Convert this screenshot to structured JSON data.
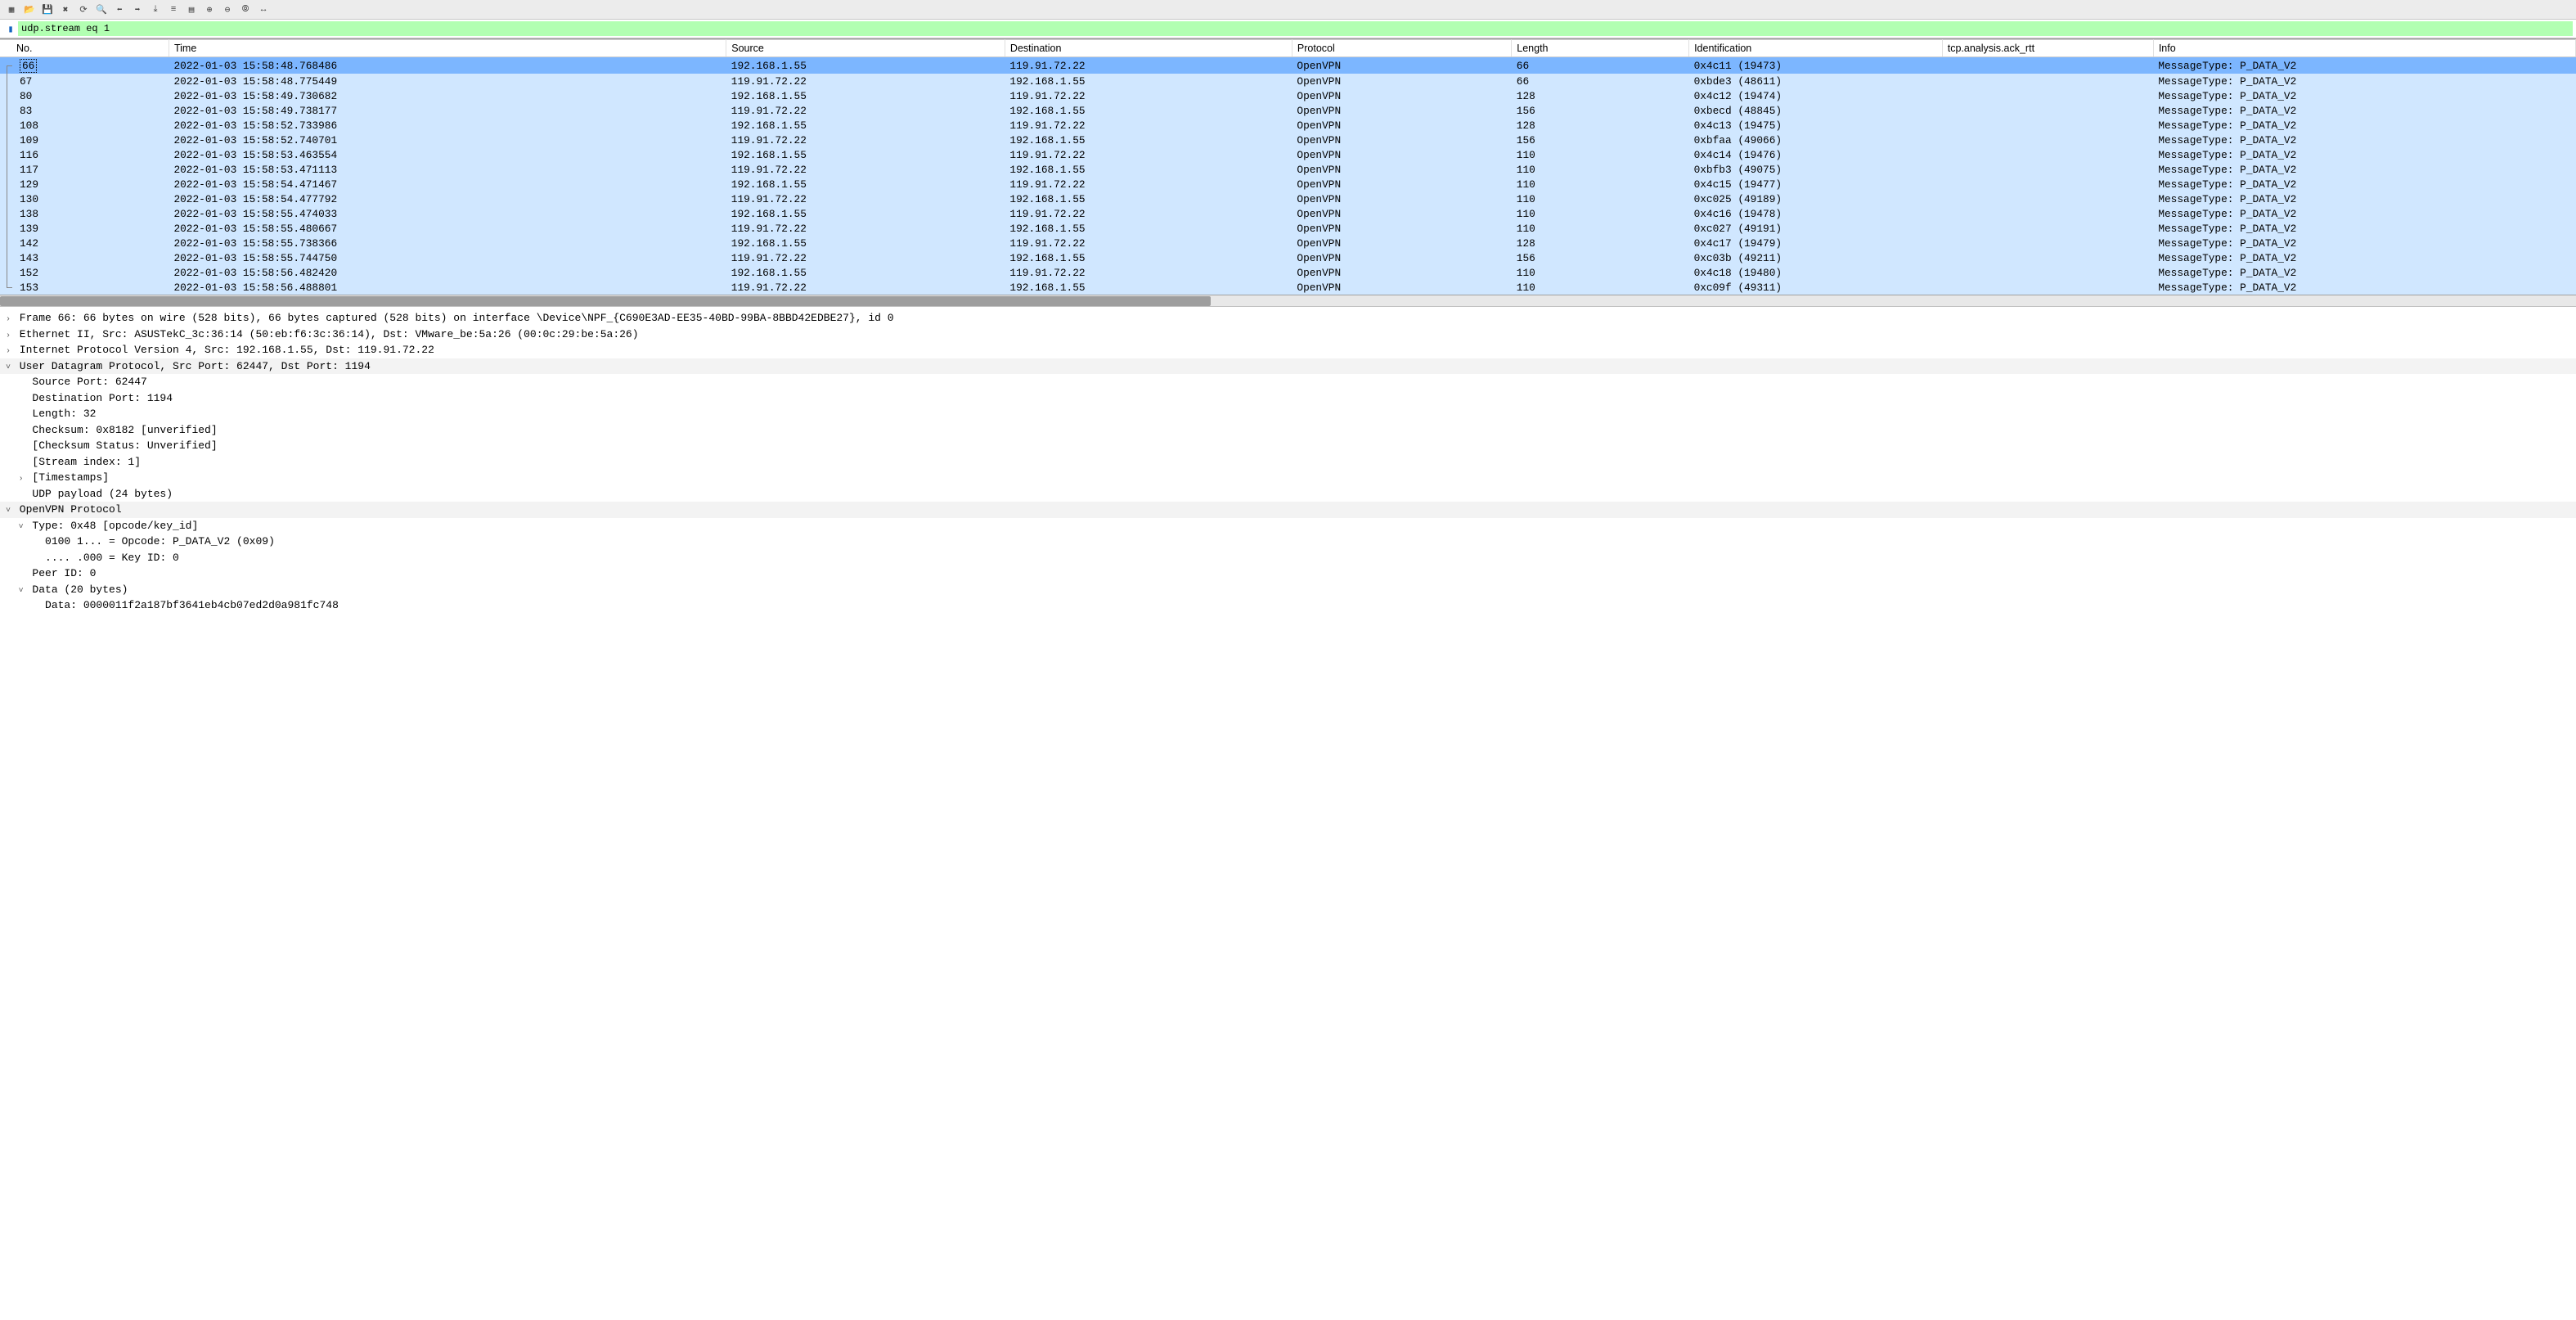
{
  "toolbar_icons": [
    "file-icon",
    "open-icon",
    "save-icon",
    "close-icon",
    "reload-icon",
    "find-icon",
    "go-back-icon",
    "go-fwd-icon",
    "go-last-icon",
    "auto-scroll-icon",
    "colorize-icon",
    "zoom-in-icon",
    "zoom-out-icon",
    "zoom-reset-icon",
    "resize-icon"
  ],
  "filter": {
    "value": "udp.stream eq 1"
  },
  "columns": {
    "no": "No.",
    "time": "Time",
    "src": "Source",
    "dst": "Destination",
    "proto": "Protocol",
    "len": "Length",
    "id": "Identification",
    "rtt": "tcp.analysis.ack_rtt",
    "info": "Info"
  },
  "rows": [
    {
      "no": "66",
      "time": "2022-01-03 15:58:48.768486",
      "src": "192.168.1.55",
      "dst": "119.91.72.22",
      "proto": "OpenVPN",
      "len": "66",
      "id": "0x4c11 (19473)",
      "info": "MessageType: P_DATA_V2",
      "sel": true
    },
    {
      "no": "67",
      "time": "2022-01-03 15:58:48.775449",
      "src": "119.91.72.22",
      "dst": "192.168.1.55",
      "proto": "OpenVPN",
      "len": "66",
      "id": "0xbde3 (48611)",
      "info": "MessageType: P_DATA_V2"
    },
    {
      "no": "80",
      "time": "2022-01-03 15:58:49.730682",
      "src": "192.168.1.55",
      "dst": "119.91.72.22",
      "proto": "OpenVPN",
      "len": "128",
      "id": "0x4c12 (19474)",
      "info": "MessageType: P_DATA_V2"
    },
    {
      "no": "83",
      "time": "2022-01-03 15:58:49.738177",
      "src": "119.91.72.22",
      "dst": "192.168.1.55",
      "proto": "OpenVPN",
      "len": "156",
      "id": "0xbecd (48845)",
      "info": "MessageType: P_DATA_V2"
    },
    {
      "no": "108",
      "time": "2022-01-03 15:58:52.733986",
      "src": "192.168.1.55",
      "dst": "119.91.72.22",
      "proto": "OpenVPN",
      "len": "128",
      "id": "0x4c13 (19475)",
      "info": "MessageType: P_DATA_V2"
    },
    {
      "no": "109",
      "time": "2022-01-03 15:58:52.740701",
      "src": "119.91.72.22",
      "dst": "192.168.1.55",
      "proto": "OpenVPN",
      "len": "156",
      "id": "0xbfaa (49066)",
      "info": "MessageType: P_DATA_V2"
    },
    {
      "no": "116",
      "time": "2022-01-03 15:58:53.463554",
      "src": "192.168.1.55",
      "dst": "119.91.72.22",
      "proto": "OpenVPN",
      "len": "110",
      "id": "0x4c14 (19476)",
      "info": "MessageType: P_DATA_V2"
    },
    {
      "no": "117",
      "time": "2022-01-03 15:58:53.471113",
      "src": "119.91.72.22",
      "dst": "192.168.1.55",
      "proto": "OpenVPN",
      "len": "110",
      "id": "0xbfb3 (49075)",
      "info": "MessageType: P_DATA_V2"
    },
    {
      "no": "129",
      "time": "2022-01-03 15:58:54.471467",
      "src": "192.168.1.55",
      "dst": "119.91.72.22",
      "proto": "OpenVPN",
      "len": "110",
      "id": "0x4c15 (19477)",
      "info": "MessageType: P_DATA_V2"
    },
    {
      "no": "130",
      "time": "2022-01-03 15:58:54.477792",
      "src": "119.91.72.22",
      "dst": "192.168.1.55",
      "proto": "OpenVPN",
      "len": "110",
      "id": "0xc025 (49189)",
      "info": "MessageType: P_DATA_V2"
    },
    {
      "no": "138",
      "time": "2022-01-03 15:58:55.474033",
      "src": "192.168.1.55",
      "dst": "119.91.72.22",
      "proto": "OpenVPN",
      "len": "110",
      "id": "0x4c16 (19478)",
      "info": "MessageType: P_DATA_V2"
    },
    {
      "no": "139",
      "time": "2022-01-03 15:58:55.480667",
      "src": "119.91.72.22",
      "dst": "192.168.1.55",
      "proto": "OpenVPN",
      "len": "110",
      "id": "0xc027 (49191)",
      "info": "MessageType: P_DATA_V2"
    },
    {
      "no": "142",
      "time": "2022-01-03 15:58:55.738366",
      "src": "192.168.1.55",
      "dst": "119.91.72.22",
      "proto": "OpenVPN",
      "len": "128",
      "id": "0x4c17 (19479)",
      "info": "MessageType: P_DATA_V2"
    },
    {
      "no": "143",
      "time": "2022-01-03 15:58:55.744750",
      "src": "119.91.72.22",
      "dst": "192.168.1.55",
      "proto": "OpenVPN",
      "len": "156",
      "id": "0xc03b (49211)",
      "info": "MessageType: P_DATA_V2"
    },
    {
      "no": "152",
      "time": "2022-01-03 15:58:56.482420",
      "src": "192.168.1.55",
      "dst": "119.91.72.22",
      "proto": "OpenVPN",
      "len": "110",
      "id": "0x4c18 (19480)",
      "info": "MessageType: P_DATA_V2"
    },
    {
      "no": "153",
      "time": "2022-01-03 15:58:56.488801",
      "src": "119.91.72.22",
      "dst": "192.168.1.55",
      "proto": "OpenVPN",
      "len": "110",
      "id": "0xc09f (49311)",
      "info": "MessageType: P_DATA_V2"
    }
  ],
  "detail_lines": [
    {
      "indent": 0,
      "tw": ">",
      "hl": false,
      "text": "Frame 66: 66 bytes on wire (528 bits), 66 bytes captured (528 bits) on interface \\Device\\NPF_{C690E3AD-EE35-40BD-99BA-8BBD42EDBE27}, id 0"
    },
    {
      "indent": 0,
      "tw": ">",
      "hl": false,
      "text": "Ethernet II, Src: ASUSTekC_3c:36:14 (50:eb:f6:3c:36:14), Dst: VMware_be:5a:26 (00:0c:29:be:5a:26)"
    },
    {
      "indent": 0,
      "tw": ">",
      "hl": false,
      "text": "Internet Protocol Version 4, Src: 192.168.1.55, Dst: 119.91.72.22"
    },
    {
      "indent": 0,
      "tw": "v",
      "hl": true,
      "text": "User Datagram Protocol, Src Port: 62447, Dst Port: 1194"
    },
    {
      "indent": 1,
      "tw": "",
      "hl": false,
      "text": "Source Port: 62447"
    },
    {
      "indent": 1,
      "tw": "",
      "hl": false,
      "text": "Destination Port: 1194"
    },
    {
      "indent": 1,
      "tw": "",
      "hl": false,
      "text": "Length: 32"
    },
    {
      "indent": 1,
      "tw": "",
      "hl": false,
      "text": "Checksum: 0x8182 [unverified]"
    },
    {
      "indent": 1,
      "tw": "",
      "hl": false,
      "text": "[Checksum Status: Unverified]"
    },
    {
      "indent": 1,
      "tw": "",
      "hl": false,
      "text": "[Stream index: 1]"
    },
    {
      "indent": 1,
      "tw": ">",
      "hl": false,
      "text": "[Timestamps]"
    },
    {
      "indent": 1,
      "tw": "",
      "hl": false,
      "text": "UDP payload (24 bytes)"
    },
    {
      "indent": 0,
      "tw": "v",
      "hl": true,
      "text": "OpenVPN Protocol"
    },
    {
      "indent": 1,
      "tw": "v",
      "hl": false,
      "text": "Type: 0x48 [opcode/key_id]"
    },
    {
      "indent": 2,
      "tw": "",
      "hl": false,
      "text": "0100 1... = Opcode: P_DATA_V2 (0x09)"
    },
    {
      "indent": 2,
      "tw": "",
      "hl": false,
      "text": ".... .000 = Key ID: 0"
    },
    {
      "indent": 1,
      "tw": "",
      "hl": false,
      "text": "Peer ID: 0"
    },
    {
      "indent": 1,
      "tw": "v",
      "hl": false,
      "text": "Data (20 bytes)"
    },
    {
      "indent": 2,
      "tw": "",
      "hl": false,
      "text": "Data: 0000011f2a187bf3641eb4cb07ed2d0a981fc748"
    }
  ]
}
